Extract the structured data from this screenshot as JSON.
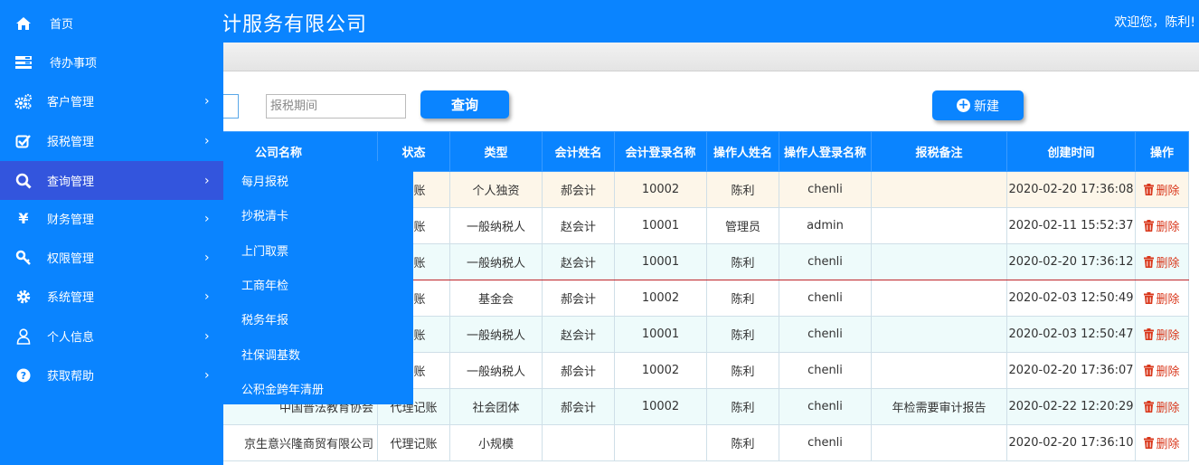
{
  "header": {
    "title": "计服务有限公司",
    "welcome": "欢迎您，陈利!"
  },
  "search": {
    "period_placeholder": "报税期间",
    "query_label": "查询",
    "new_label": "新建"
  },
  "table": {
    "headers": [
      "公司名称",
      "状态",
      "类型",
      "会计姓名",
      "会计登录名称",
      "操作人姓名",
      "操作人登录名称",
      "报税备注",
      "创建时间",
      "操作"
    ],
    "rows": [
      {
        "company": "",
        "status": "记账",
        "type": "个人独资",
        "accountant": "郝会计",
        "acc_login": "10002",
        "operator": "陈利",
        "op_login": "chenli",
        "remark": "",
        "created": "2020-02-20 17:36:08",
        "action": "删除"
      },
      {
        "company": "",
        "status": "记账",
        "type": "一般纳税人",
        "accountant": "赵会计",
        "acc_login": "10001",
        "operator": "管理员",
        "op_login": "admin",
        "remark": "",
        "created": "2020-02-11 15:52:37",
        "action": "删除"
      },
      {
        "company": "",
        "status": "记账",
        "type": "一般纳税人",
        "accountant": "赵会计",
        "acc_login": "10001",
        "operator": "陈利",
        "op_login": "chenli",
        "remark": "",
        "created": "2020-02-20 17:36:12",
        "action": "删除"
      },
      {
        "company": "",
        "status": "记账",
        "type": "基金会",
        "accountant": "郝会计",
        "acc_login": "10002",
        "operator": "陈利",
        "op_login": "chenli",
        "remark": "",
        "created": "2020-02-03 12:50:49",
        "action": "删除"
      },
      {
        "company": "",
        "status": "做账",
        "type": "一般纳税人",
        "accountant": "赵会计",
        "acc_login": "10001",
        "operator": "陈利",
        "op_login": "chenli",
        "remark": "",
        "created": "2020-02-03 12:50:47",
        "action": "删除"
      },
      {
        "company": "",
        "status": "记账",
        "type": "一般纳税人",
        "accountant": "郝会计",
        "acc_login": "10002",
        "operator": "陈利",
        "op_login": "chenli",
        "remark": "",
        "created": "2020-02-20 17:36:07",
        "action": "删除"
      },
      {
        "company": "中国普法教育协会",
        "status": "代理记账",
        "type": "社会团体",
        "accountant": "郝会计",
        "acc_login": "10002",
        "operator": "陈利",
        "op_login": "chenli",
        "remark": "年检需要审计报告",
        "created": "2020-02-22 12:20:29",
        "action": "删除"
      },
      {
        "company": "京生意兴隆商贸有限公司",
        "status": "代理记账",
        "type": "小规模",
        "accountant": "",
        "acc_login": "",
        "operator": "陈利",
        "op_login": "chenli",
        "remark": "",
        "created": "2020-02-20 17:36:10",
        "action": "删除"
      }
    ]
  },
  "sidebar": {
    "items": [
      {
        "label": "首页",
        "icon": "home-icon",
        "has_arrow": false
      },
      {
        "label": "待办事项",
        "icon": "list-icon",
        "has_arrow": false
      },
      {
        "label": "客户管理",
        "icon": "gears-icon",
        "has_arrow": true
      },
      {
        "label": "报税管理",
        "icon": "checkbox-icon",
        "has_arrow": true
      },
      {
        "label": "查询管理",
        "icon": "search-icon",
        "has_arrow": true,
        "active": true
      },
      {
        "label": "财务管理",
        "icon": "yen-icon",
        "has_arrow": true
      },
      {
        "label": "权限管理",
        "icon": "key-icon",
        "has_arrow": true
      },
      {
        "label": "系统管理",
        "icon": "gear-icon",
        "has_arrow": true
      },
      {
        "label": "个人信息",
        "icon": "user-icon",
        "has_arrow": true
      },
      {
        "label": "获取帮助",
        "icon": "help-icon",
        "has_arrow": true
      }
    ]
  },
  "submenu": {
    "items": [
      "每月报税",
      "抄税清卡",
      "上门取票",
      "工商年检",
      "税务年报",
      "社保调基数",
      "公积金跨年清册"
    ]
  },
  "colors": {
    "primary": "#0a84ff",
    "active_nav": "#3355dd",
    "delete": "#d9371b"
  }
}
